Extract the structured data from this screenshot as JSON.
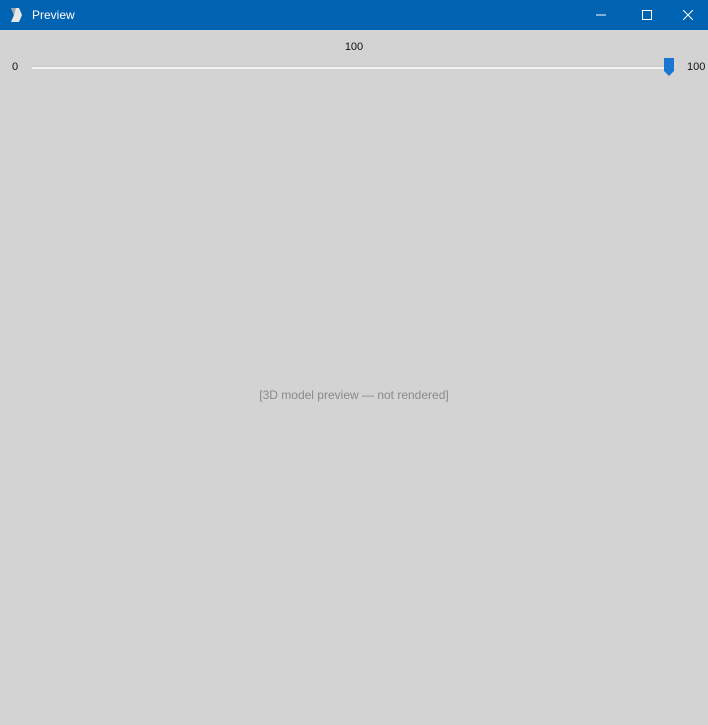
{
  "window": {
    "title": "Preview",
    "icons": {
      "app": "app-icon",
      "minimize": "minimize-icon",
      "maximize": "maximize-icon",
      "close": "close-icon"
    },
    "colors": {
      "titlebar": "#0063b1",
      "background": "#d3d3d3",
      "accent": "#1976d2"
    }
  },
  "slider": {
    "value": "100",
    "min_label": "0",
    "max_label": "100",
    "fraction": 1.0
  },
  "viewport": {
    "note": "[3D model preview — not rendered]"
  }
}
